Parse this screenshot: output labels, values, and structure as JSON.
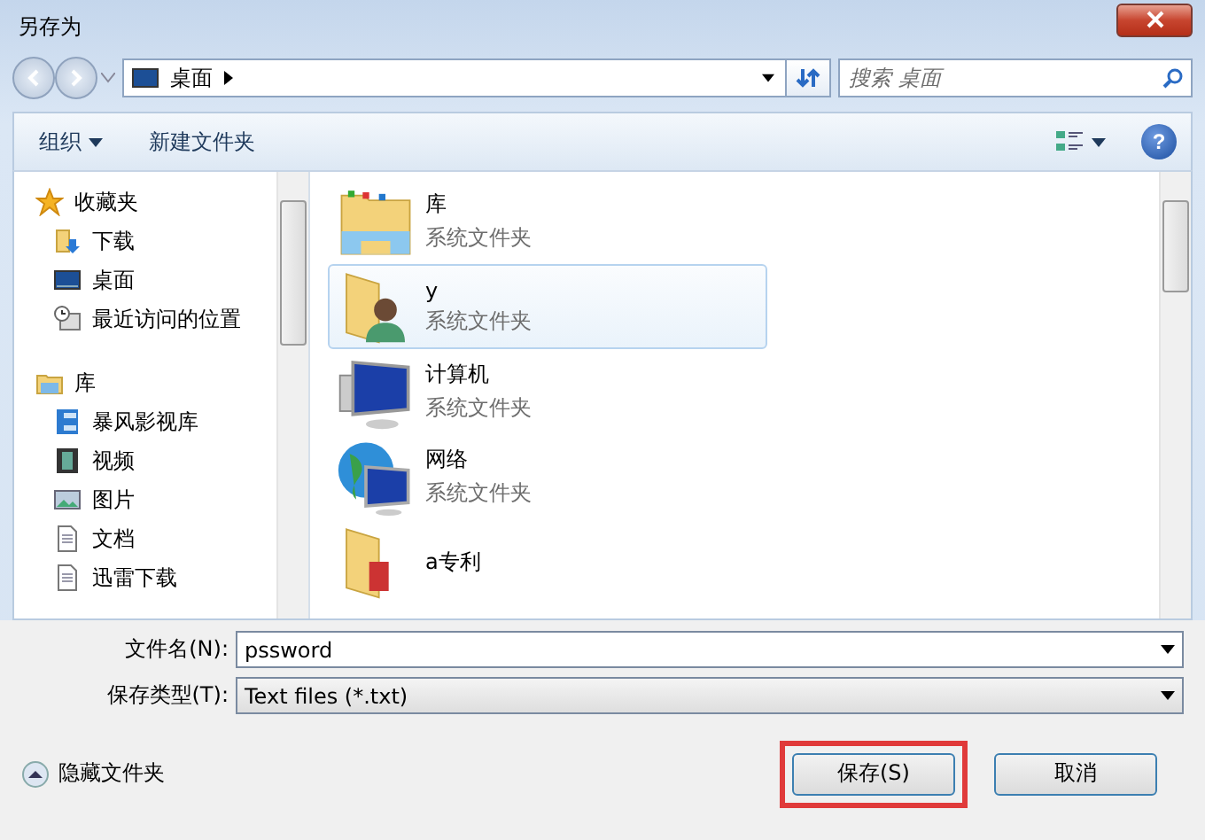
{
  "window": {
    "title": "另存为"
  },
  "address": {
    "location": "桌面"
  },
  "search": {
    "placeholder": "搜索 桌面"
  },
  "toolbar": {
    "organize": "组织",
    "new_folder": "新建文件夹",
    "help": "?"
  },
  "sidebar": {
    "groups": [
      {
        "label": "收藏夹",
        "kind": "favorites",
        "children": [
          {
            "label": "下载",
            "kind": "download"
          },
          {
            "label": "桌面",
            "kind": "desktop"
          },
          {
            "label": "最近访问的位置",
            "kind": "recent"
          }
        ]
      },
      {
        "label": "库",
        "kind": "library",
        "children": [
          {
            "label": "暴风影视库",
            "kind": "media"
          },
          {
            "label": "视频",
            "kind": "video"
          },
          {
            "label": "图片",
            "kind": "picture"
          },
          {
            "label": "文档",
            "kind": "document"
          },
          {
            "label": "迅雷下载",
            "kind": "document"
          }
        ]
      }
    ]
  },
  "items": [
    {
      "name": "库",
      "type": "系统文件夹",
      "kind": "library",
      "selected": false
    },
    {
      "name": "y",
      "type": "系统文件夹",
      "kind": "user",
      "selected": true
    },
    {
      "name": "计算机",
      "type": "系统文件夹",
      "kind": "computer",
      "selected": false
    },
    {
      "name": "网络",
      "type": "系统文件夹",
      "kind": "network",
      "selected": false
    },
    {
      "name": "a专利",
      "kind": "folder",
      "selected": false
    }
  ],
  "filename": {
    "label": "文件名(N):",
    "value": "pssword"
  },
  "filetype": {
    "label": "保存类型(T):",
    "value": "Text files (*.txt)"
  },
  "hide_folders": "隐藏文件夹",
  "buttons": [
    {
      "label": "保存(S)",
      "highlighted": true
    },
    {
      "label": "取消",
      "highlighted": false
    }
  ]
}
